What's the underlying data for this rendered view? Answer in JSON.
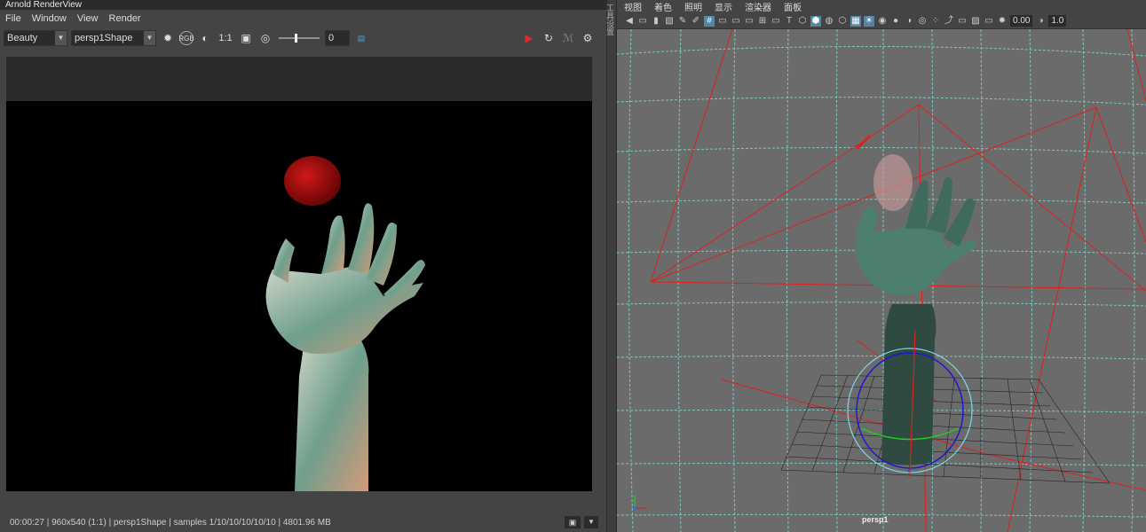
{
  "render_view": {
    "title": "Arnold RenderView",
    "menu": [
      "File",
      "Window",
      "View",
      "Render"
    ],
    "aov_value": "Beauty",
    "camera_value": "persp1Shape",
    "ratio_label": "1:1",
    "exposure_value": "0",
    "status_text": "00:00:27 | 960x540 (1:1) | persp1Shape  | samples 1/10/10/10/10/10 | 4801.96 MB"
  },
  "maya_viewport": {
    "side_label": "工具设置",
    "menu": [
      "视图",
      "着色",
      "照明",
      "显示",
      "渲染器",
      "面板"
    ],
    "field_value": "0.00",
    "field_value2": "1.0",
    "camera_label": "persp1"
  },
  "colors": {
    "accent_red": "#e0282c",
    "grid_line": "#7fd9d0",
    "camera_red": "#e01f1f"
  }
}
